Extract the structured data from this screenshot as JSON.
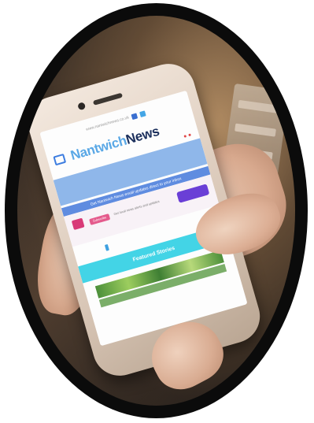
{
  "photo": {
    "subject": "hand holding smartphone showing website",
    "frame_color": "#0b0b0b"
  },
  "website": {
    "status_text": "www.nantwichnews.co.uk",
    "brand_part1": "Nantwich",
    "brand_part2": "News",
    "promo_text": "Get Nantwich News email updates direct to your inbox",
    "pink_button": "Subscribe",
    "pink_text": "Get local news alerts and updates",
    "cyan_label": "Featured Stories",
    "colors": {
      "brand_light": "#5aa8e6",
      "brand_dark": "#1b2f5c",
      "cyan": "#43d4e6",
      "purple": "#6a3fd6",
      "pink": "#e45a8c"
    },
    "icons": [
      "facebook-icon",
      "twitter-icon",
      "menu-icon"
    ]
  }
}
